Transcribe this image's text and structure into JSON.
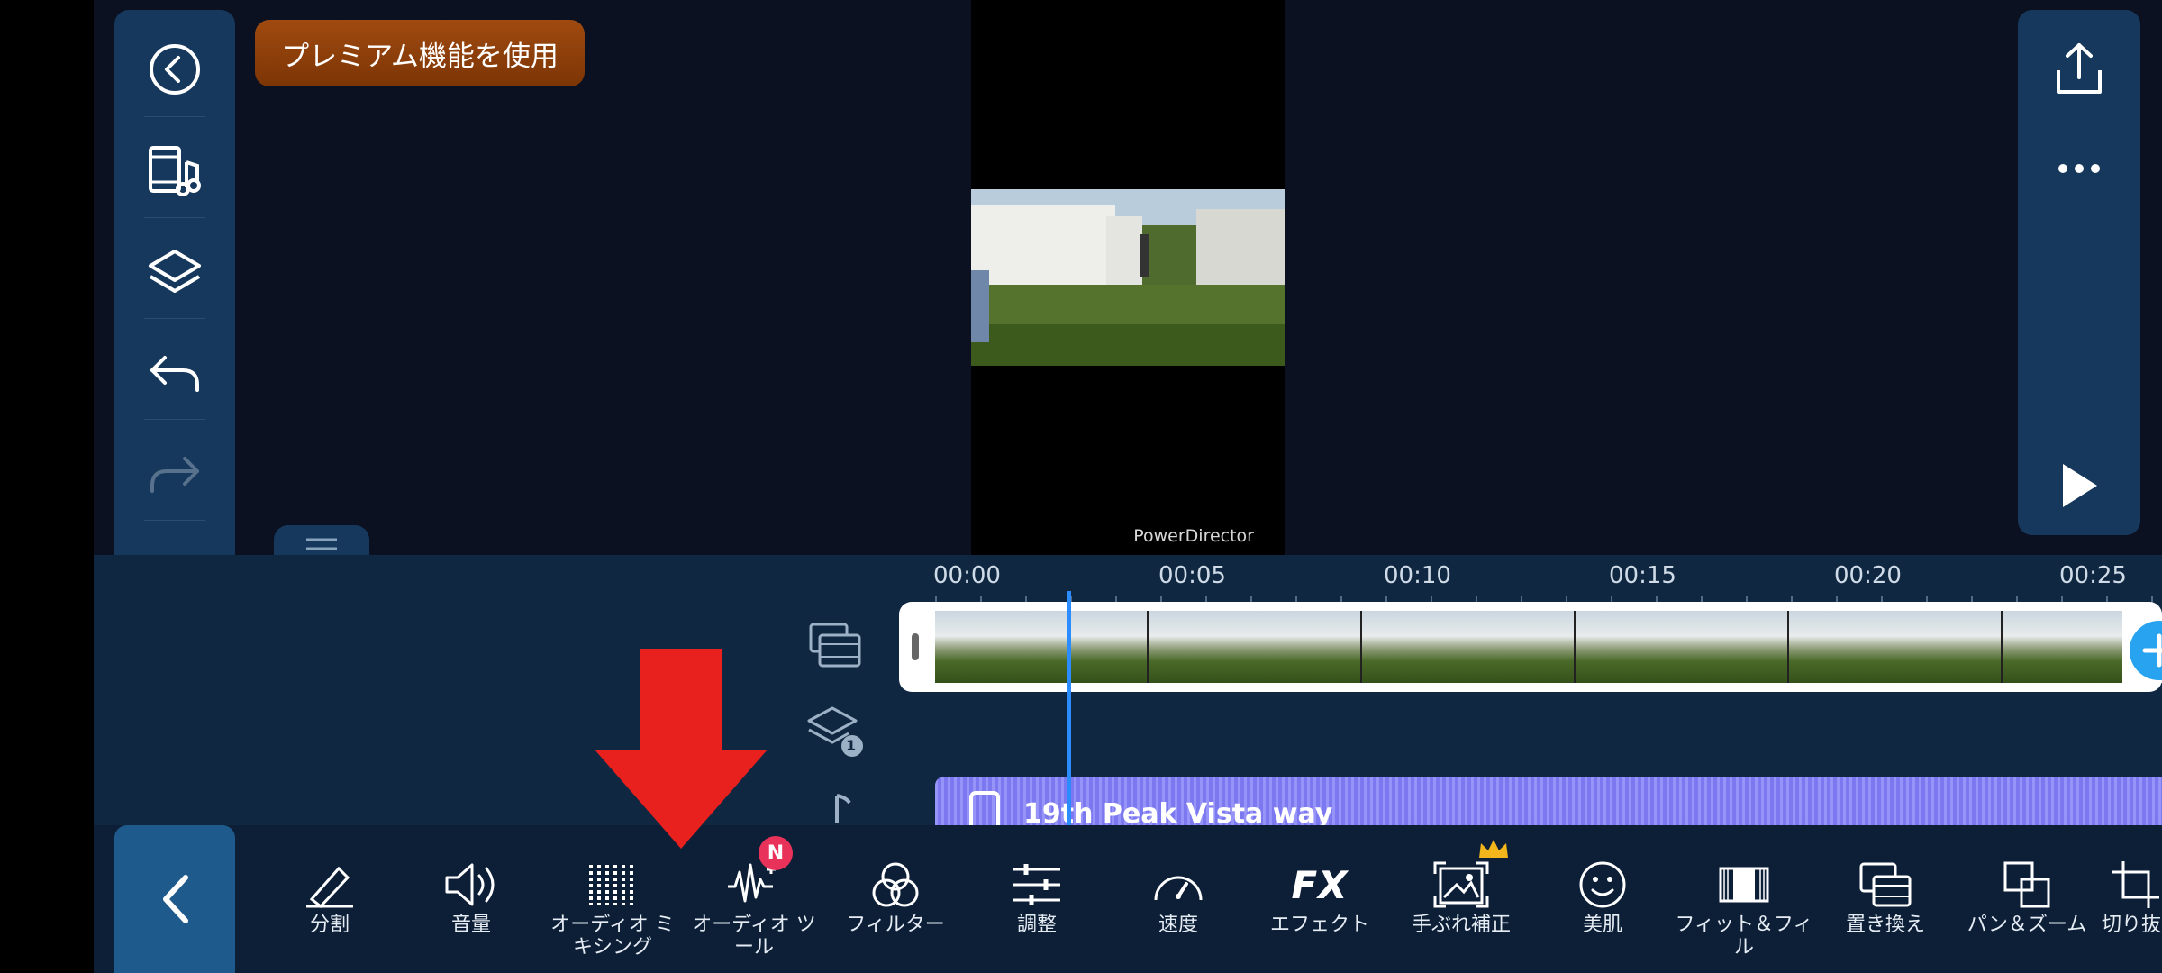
{
  "premium": {
    "label": "プレミアム機能を使用"
  },
  "preview": {
    "watermark": "PowerDirector"
  },
  "timeline": {
    "ticks": [
      "00:00",
      "00:05",
      "00:10",
      "00:15",
      "00:20",
      "00:25"
    ],
    "audio_clip_title": "19th Peak Vista way"
  },
  "toolbar": {
    "tools": [
      {
        "label": "分割"
      },
      {
        "label": "音量"
      },
      {
        "label": "オーディオ ミキシング"
      },
      {
        "label": "オーディオ ツール"
      },
      {
        "label": "フィルター"
      },
      {
        "label": "調整"
      },
      {
        "label": "速度"
      },
      {
        "label": "エフェクト"
      },
      {
        "label": "手ぶれ補正"
      },
      {
        "label": "美肌"
      },
      {
        "label": "フィット＆フィル"
      },
      {
        "label": "置き換え"
      },
      {
        "label": "パン＆ズーム"
      },
      {
        "label": "切り抜"
      }
    ],
    "new_badge": "N",
    "fx_glyph": "FX"
  },
  "layers": {
    "count": "1"
  },
  "colors": {
    "accent": "#27a3f0",
    "audio_track": "#7b78f0",
    "premium": "#8a3d08",
    "badge": "#e8325a"
  }
}
